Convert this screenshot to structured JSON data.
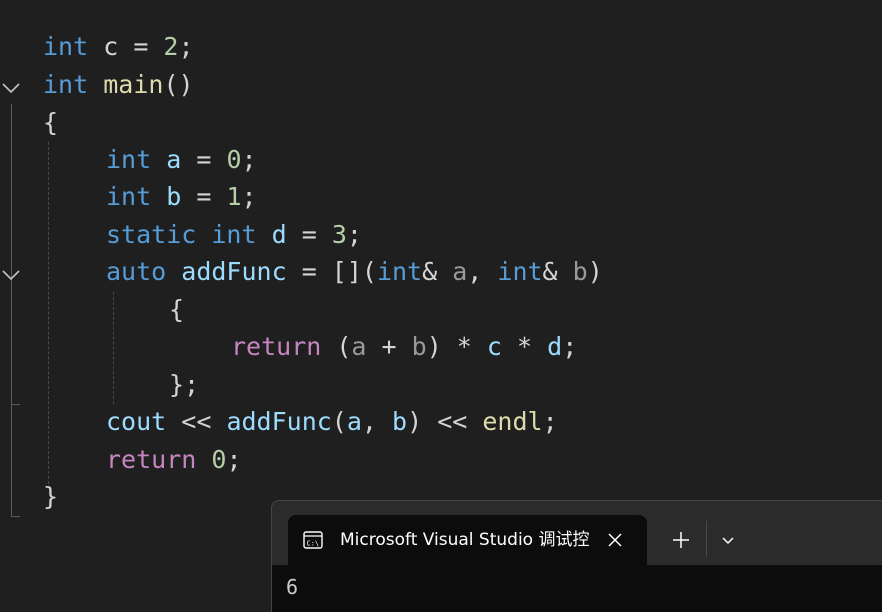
{
  "code": {
    "lines": [
      [
        {
          "text": "int",
          "cls": "kw"
        },
        {
          "text": " c ",
          "cls": "pun"
        },
        {
          "text": "= ",
          "cls": "pun"
        },
        {
          "text": "2",
          "cls": "num"
        },
        {
          "text": ";",
          "cls": "pun"
        }
      ],
      [
        {
          "text": "int",
          "cls": "kw"
        },
        {
          "text": " ",
          "cls": "pun"
        },
        {
          "text": "main",
          "cls": "fn"
        },
        {
          "text": "()",
          "cls": "pun"
        }
      ],
      [
        {
          "text": "{",
          "cls": "pun"
        }
      ],
      [
        {
          "text": "int",
          "cls": "kw"
        },
        {
          "text": " ",
          "cls": "pun"
        },
        {
          "text": "a",
          "cls": "var"
        },
        {
          "text": " = ",
          "cls": "pun"
        },
        {
          "text": "0",
          "cls": "num"
        },
        {
          "text": ";",
          "cls": "pun"
        }
      ],
      [
        {
          "text": "int",
          "cls": "kw"
        },
        {
          "text": " ",
          "cls": "pun"
        },
        {
          "text": "b",
          "cls": "var"
        },
        {
          "text": " = ",
          "cls": "pun"
        },
        {
          "text": "1",
          "cls": "num"
        },
        {
          "text": ";",
          "cls": "pun"
        }
      ],
      [
        {
          "text": "static",
          "cls": "kw"
        },
        {
          "text": " ",
          "cls": "pun"
        },
        {
          "text": "int",
          "cls": "kw"
        },
        {
          "text": " ",
          "cls": "pun"
        },
        {
          "text": "d",
          "cls": "var"
        },
        {
          "text": " = ",
          "cls": "pun"
        },
        {
          "text": "3",
          "cls": "num"
        },
        {
          "text": ";",
          "cls": "pun"
        }
      ],
      [
        {
          "text": "auto",
          "cls": "kw"
        },
        {
          "text": " ",
          "cls": "pun"
        },
        {
          "text": "addFunc",
          "cls": "var"
        },
        {
          "text": " = [](",
          "cls": "pun"
        },
        {
          "text": "int",
          "cls": "kw"
        },
        {
          "text": "& ",
          "cls": "pun"
        },
        {
          "text": "a",
          "cls": "param"
        },
        {
          "text": ", ",
          "cls": "pun"
        },
        {
          "text": "int",
          "cls": "kw"
        },
        {
          "text": "& ",
          "cls": "pun"
        },
        {
          "text": "b",
          "cls": "param"
        },
        {
          "text": ")",
          "cls": "pun"
        }
      ],
      [
        {
          "text": "{",
          "cls": "pun"
        }
      ],
      [
        {
          "text": "return",
          "cls": "ctl"
        },
        {
          "text": " (",
          "cls": "pun"
        },
        {
          "text": "a",
          "cls": "param"
        },
        {
          "text": " + ",
          "cls": "pun"
        },
        {
          "text": "b",
          "cls": "param"
        },
        {
          "text": ") * ",
          "cls": "pun"
        },
        {
          "text": "c",
          "cls": "var"
        },
        {
          "text": " * ",
          "cls": "pun"
        },
        {
          "text": "d",
          "cls": "var"
        },
        {
          "text": ";",
          "cls": "pun"
        }
      ],
      [
        {
          "text": "};",
          "cls": "pun"
        }
      ],
      [
        {
          "text": "cout",
          "cls": "var"
        },
        {
          "text": " << ",
          "cls": "pun"
        },
        {
          "text": "addFunc",
          "cls": "var"
        },
        {
          "text": "(",
          "cls": "pun"
        },
        {
          "text": "a",
          "cls": "var"
        },
        {
          "text": ", ",
          "cls": "pun"
        },
        {
          "text": "b",
          "cls": "var"
        },
        {
          "text": ") << ",
          "cls": "pun"
        },
        {
          "text": "endl",
          "cls": "fn"
        },
        {
          "text": ";",
          "cls": "pun"
        }
      ],
      [
        {
          "text": "return",
          "cls": "ctl"
        },
        {
          "text": " ",
          "cls": "pun"
        },
        {
          "text": "0",
          "cls": "num"
        },
        {
          "text": ";",
          "cls": "pun"
        }
      ],
      [
        {
          "text": "}",
          "cls": "pun"
        }
      ]
    ]
  },
  "terminal": {
    "tab_title": "Microsoft Visual Studio 调试控",
    "output": "6",
    "icons": {
      "tab": "console-icon",
      "close": "close-icon",
      "new_tab": "plus-icon",
      "dropdown": "chevron-down-icon"
    }
  },
  "colors": {
    "editor_bg": "#1f1f1f",
    "keyword": "#569cd6",
    "control": "#c586c0",
    "function": "#dcdcaa",
    "variable": "#9cdcfe",
    "number": "#b5cea8",
    "terminal_bg": "#0c0c0c"
  }
}
